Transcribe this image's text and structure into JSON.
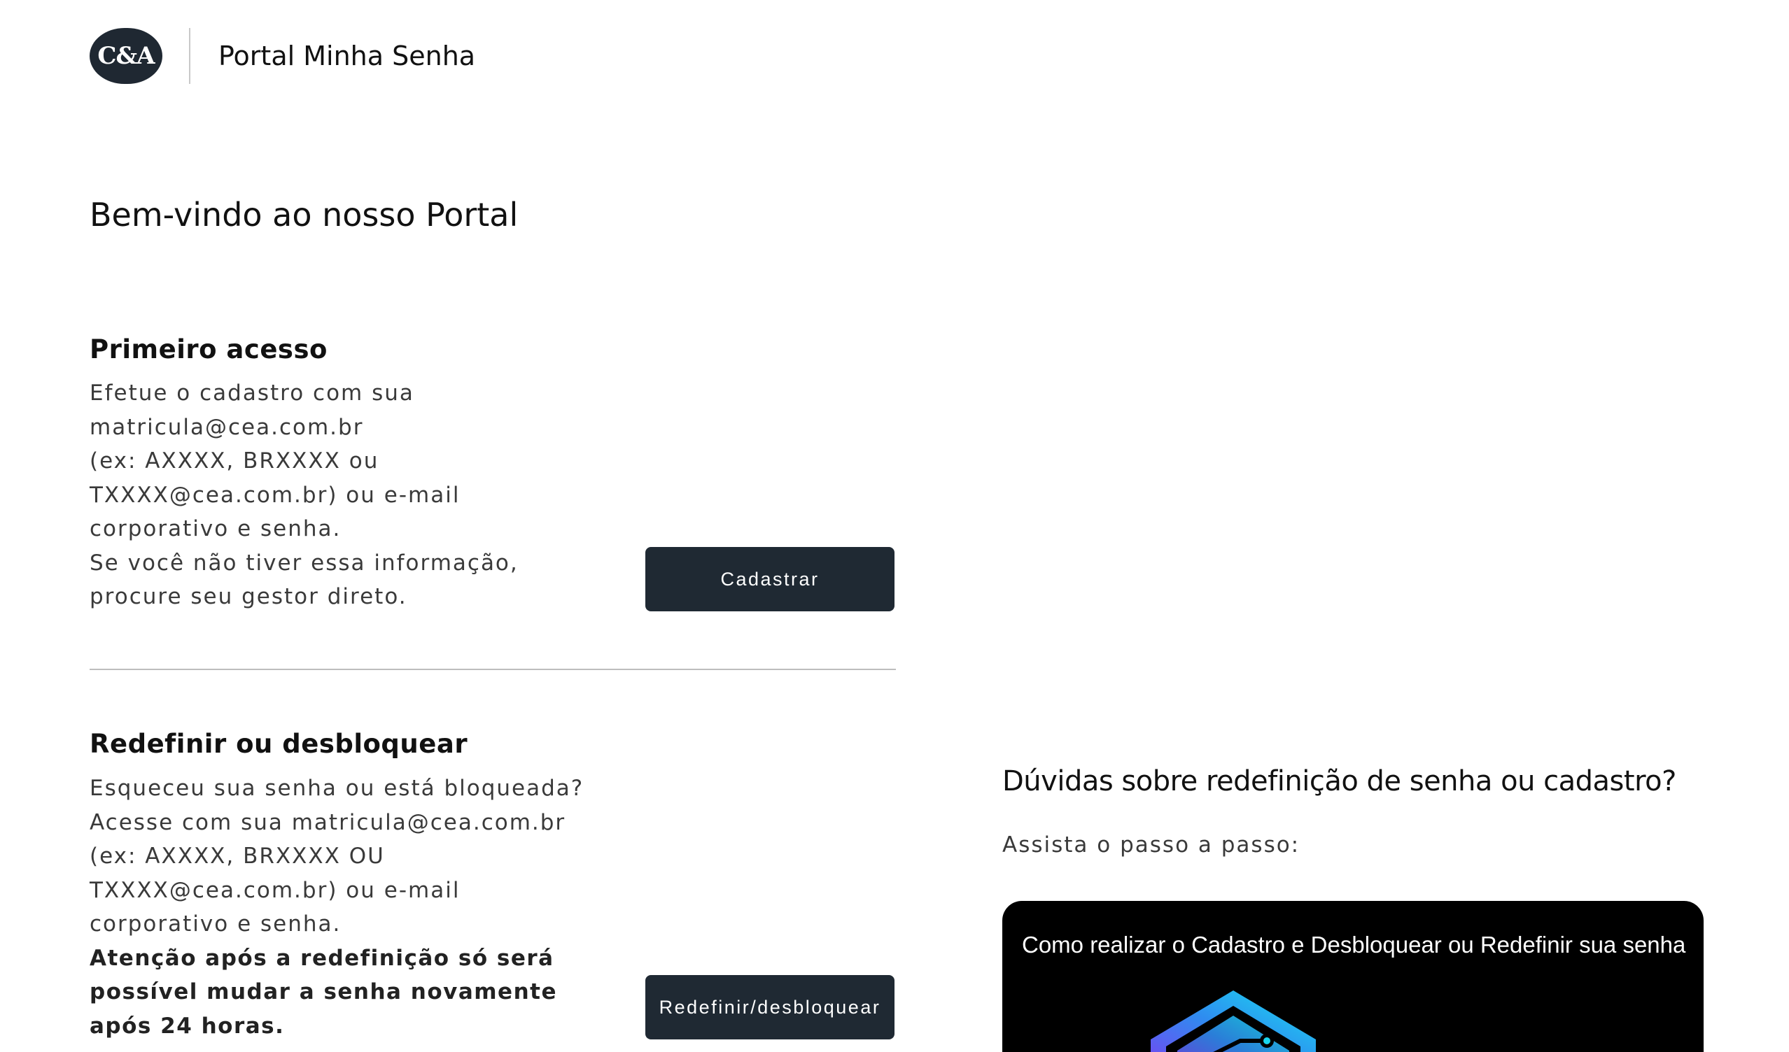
{
  "header": {
    "logo_text": "C&A",
    "portal_title": "Portal Minha Senha"
  },
  "welcome_title": "Bem-vindo ao nosso Portal",
  "first_access": {
    "title": "Primeiro acesso",
    "lines": [
      "Efetue o cadastro com sua",
      "matricula@cea.com.br",
      "(ex: AXXXX, BRXXXX ou",
      "TXXXX@cea.com.br) ou e-mail",
      "corporativo e senha.",
      "Se você não tiver essa informação,",
      "procure seu gestor direto."
    ],
    "button_label": "Cadastrar"
  },
  "reset": {
    "title": "Redefinir ou desbloquear",
    "lines": [
      "Esqueceu sua senha ou está bloqueada?",
      "Acesse com sua matricula@cea.com.br",
      "(ex: AXXXX, BRXXXX OU",
      "TXXXX@cea.com.br) ou e-mail",
      "corporativo e senha."
    ],
    "warning_lines": [
      "Atenção após a redefinição só será",
      "possível mudar a senha novamente",
      "após 24 horas."
    ],
    "button_label": "Redefinir/desbloquear"
  },
  "help": {
    "title": "Dúvidas sobre redefinição de senha ou cadastro?",
    "subtitle": "Assista o passo a passo:",
    "video_title": "Como realizar o Cadastro e Desbloquear ou Redefinir sua senha",
    "video_icon": "circuit-shield-icon"
  },
  "colors": {
    "button_bg": "#1f2933",
    "logo_bg": "#1f2832",
    "text_dark": "#111111",
    "text_body": "#3a3a3a",
    "video_bg": "#000000"
  }
}
